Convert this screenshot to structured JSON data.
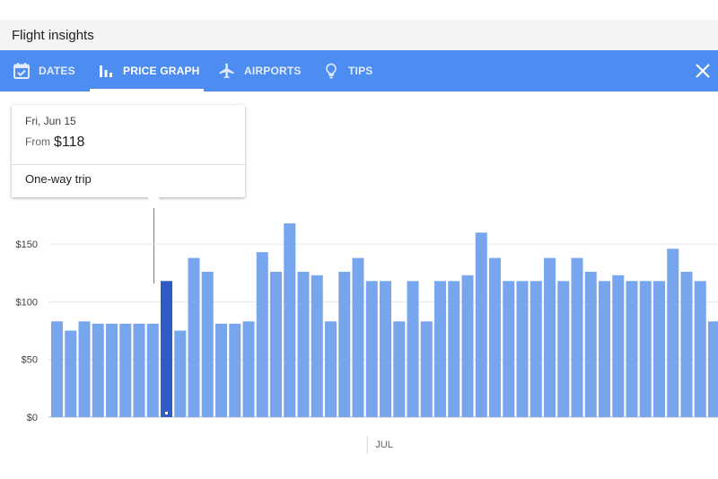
{
  "window": {
    "title": "Flight insights"
  },
  "tabs": [
    {
      "label": "DATES",
      "icon": "calendar-check-icon"
    },
    {
      "label": "PRICE GRAPH",
      "icon": "bar-chart-icon",
      "active": true
    },
    {
      "label": "AIRPORTS",
      "icon": "airplane-icon"
    },
    {
      "label": "TIPS",
      "icon": "lightbulb-icon"
    }
  ],
  "tooltip": {
    "date": "Fri, Jun 15",
    "from_label": "From",
    "price": "$118",
    "trip_type": "One-way trip"
  },
  "colors": {
    "toolbar": "#4d8cf0",
    "bar": "#78a6ee",
    "bar_selected": "#2f5cc4"
  },
  "chart_data": {
    "type": "bar",
    "values": [
      83,
      75,
      83,
      81,
      81,
      81,
      81,
      81,
      118,
      75,
      138,
      126,
      81,
      81,
      83,
      143,
      126,
      168,
      126,
      123,
      83,
      126,
      138,
      118,
      118,
      83,
      118,
      83,
      118,
      118,
      123,
      160,
      138,
      118,
      118,
      118,
      138,
      118,
      138,
      126,
      118,
      123,
      118,
      118,
      118,
      146,
      126,
      118,
      83,
      83
    ],
    "selected_index": 8,
    "ylim": [
      0,
      175
    ],
    "yticks": [
      {
        "value": 0,
        "label": "$0"
      },
      {
        "value": 50,
        "label": "$50"
      },
      {
        "value": 100,
        "label": "$100"
      },
      {
        "value": 150,
        "label": "$150"
      }
    ],
    "xmarkers": [
      {
        "index": 23,
        "label": "JUL"
      }
    ]
  }
}
